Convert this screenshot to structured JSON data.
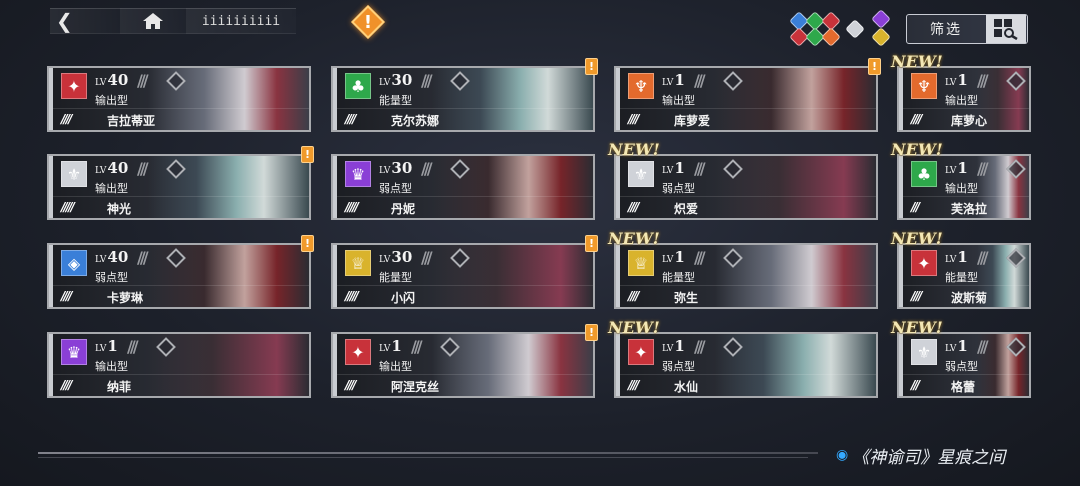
{
  "topbar": {
    "menu_label": "iiiiiiiiii"
  },
  "alert": {
    "mark": "!"
  },
  "filter": {
    "label": "筛选"
  },
  "location": {
    "text": "《神谕司》星痕之间"
  },
  "new_label": "NEW!",
  "level_prefix": "LV",
  "cards": [
    {
      "level": "40",
      "type": "输出型",
      "name": "吉拉蒂亚",
      "stars": "////",
      "element_color": "#c8323a",
      "role_glyph": "✦",
      "new": false,
      "alert": false
    },
    {
      "level": "30",
      "type": "能量型",
      "name": "克尔苏娜",
      "stars": "////",
      "element_color": "#2ea84b",
      "role_glyph": "♣",
      "new": false,
      "alert": true
    },
    {
      "level": "1",
      "type": "输出型",
      "name": "库萝爱",
      "stars": "////",
      "element_color": "#e36a2d",
      "role_glyph": "♆",
      "new": false,
      "alert": true
    },
    {
      "level": "1",
      "type": "输出型",
      "name": "库萝心",
      "stars": "////",
      "element_color": "#e36a2d",
      "role_glyph": "♆",
      "new": true,
      "alert": false
    },
    {
      "level": "40",
      "type": "输出型",
      "name": "神光",
      "stars": "/////",
      "element_color": "#cfd2d8",
      "role_glyph": "⚜",
      "new": false,
      "alert": true
    },
    {
      "level": "30",
      "type": "弱点型",
      "name": "丹妮",
      "stars": "/////",
      "element_color": "#8a3fd6",
      "role_glyph": "♛",
      "new": false,
      "alert": false
    },
    {
      "level": "1",
      "type": "弱点型",
      "name": "炽爱",
      "stars": "////",
      "element_color": "#cfd2d8",
      "role_glyph": "⚜",
      "new": true,
      "alert": false
    },
    {
      "level": "1",
      "type": "输出型",
      "name": "芙洛拉",
      "stars": "///",
      "element_color": "#2ea84b",
      "role_glyph": "♣",
      "new": true,
      "alert": false
    },
    {
      "level": "40",
      "type": "弱点型",
      "name": "卡萝琳",
      "stars": "////",
      "element_color": "#3a7fd8",
      "role_glyph": "◈",
      "new": false,
      "alert": true
    },
    {
      "level": "30",
      "type": "能量型",
      "name": "小闪",
      "stars": "/////",
      "element_color": "#d9b32c",
      "role_glyph": "♕",
      "new": false,
      "alert": true
    },
    {
      "level": "1",
      "type": "能量型",
      "name": "弥生",
      "stars": "////",
      "element_color": "#d9b32c",
      "role_glyph": "♕",
      "new": true,
      "alert": false
    },
    {
      "level": "1",
      "type": "能量型",
      "name": "波斯菊",
      "stars": "////",
      "element_color": "#c8323a",
      "role_glyph": "✦",
      "new": true,
      "alert": false
    },
    {
      "level": "1",
      "type": "输出型",
      "name": "纳菲",
      "stars": "////",
      "element_color": "#8a3fd6",
      "role_glyph": "♛",
      "new": false,
      "alert": false
    },
    {
      "level": "1",
      "type": "输出型",
      "name": "阿涅克丝",
      "stars": "////",
      "element_color": "#c8323a",
      "role_glyph": "✦",
      "new": false,
      "alert": true
    },
    {
      "level": "1",
      "type": "弱点型",
      "name": "水仙",
      "stars": "////",
      "element_color": "#c8323a",
      "role_glyph": "✦",
      "new": true,
      "alert": false
    },
    {
      "level": "1",
      "type": "弱点型",
      "name": "格蕾",
      "stars": "///",
      "element_color": "#cfd2d8",
      "role_glyph": "⚜",
      "new": true,
      "alert": false
    }
  ]
}
